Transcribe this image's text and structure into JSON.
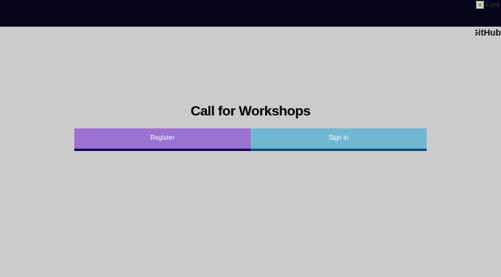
{
  "header": {
    "ribbon_alt_text": "Fork me on",
    "github_label": "GitHub"
  },
  "main": {
    "title": "Call for Workshops",
    "register_label": "Register",
    "signin_label": "Sign in"
  },
  "colors": {
    "topbar": "#05031a",
    "background": "#cbcbcb",
    "register": "#9a72d2",
    "signin": "#71b7d2"
  }
}
